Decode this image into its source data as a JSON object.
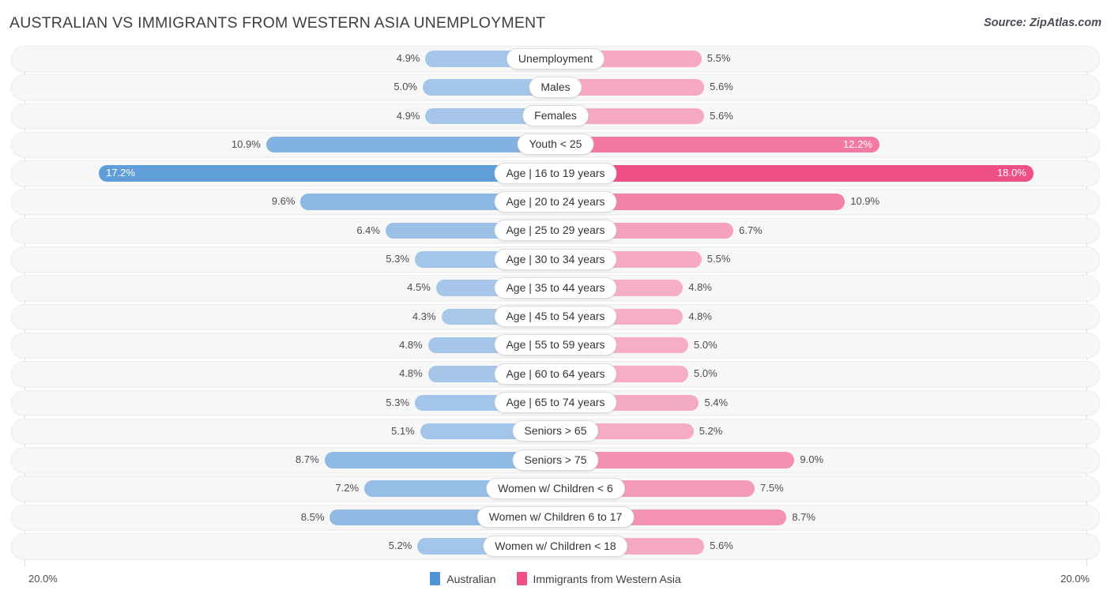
{
  "header": {
    "title": "AUSTRALIAN VS IMMIGRANTS FROM WESTERN ASIA UNEMPLOYMENT",
    "source": "Source: ZipAtlas.com"
  },
  "axis": {
    "left_label": "20.0%",
    "right_label": "20.0%",
    "max": 20.0
  },
  "legend": {
    "items": [
      {
        "label": "Australian",
        "color": "#4e94d4"
      },
      {
        "label": "Immigrants from Western Asia",
        "color": "#ef4f87"
      }
    ]
  },
  "colors": {
    "left_light": "#a8c8ea",
    "left_dark": "#5a9bd8",
    "right_light": "#f6b2c8",
    "right_dark": "#ef4f87",
    "track": "#f7f7f7",
    "gridline": "#e2e2e6"
  },
  "chart_data": {
    "type": "bar",
    "orientation": "horizontal-diverging",
    "title": "AUSTRALIAN VS IMMIGRANTS FROM WESTERN ASIA UNEMPLOYMENT",
    "xlabel": "",
    "ylabel": "",
    "xlim": [
      20.0,
      20.0
    ],
    "grid": true,
    "legend_position": "bottom-center",
    "unit": "%",
    "categories": [
      "Unemployment",
      "Males",
      "Females",
      "Youth < 25",
      "Age | 16 to 19 years",
      "Age | 20 to 24 years",
      "Age | 25 to 29 years",
      "Age | 30 to 34 years",
      "Age | 35 to 44 years",
      "Age | 45 to 54 years",
      "Age | 55 to 59 years",
      "Age | 60 to 64 years",
      "Age | 65 to 74 years",
      "Seniors > 65",
      "Seniors > 75",
      "Women w/ Children < 6",
      "Women w/ Children 6 to 17",
      "Women w/ Children < 18"
    ],
    "series": [
      {
        "name": "Australian",
        "values": [
          4.9,
          5.0,
          4.9,
          10.9,
          17.2,
          9.6,
          6.4,
          5.3,
          4.5,
          4.3,
          4.8,
          4.8,
          5.3,
          5.1,
          8.7,
          7.2,
          8.5,
          5.2
        ]
      },
      {
        "name": "Immigrants from Western Asia",
        "values": [
          5.5,
          5.6,
          5.6,
          12.2,
          18.0,
          10.9,
          6.7,
          5.5,
          4.8,
          4.8,
          5.0,
          5.0,
          5.4,
          5.2,
          9.0,
          7.5,
          8.7,
          5.6
        ]
      }
    ]
  },
  "rows": [
    {
      "label": "Unemployment",
      "left": 4.9,
      "left_text": "4.9%",
      "right": 5.5,
      "right_text": "5.5%"
    },
    {
      "label": "Males",
      "left": 5.0,
      "left_text": "5.0%",
      "right": 5.6,
      "right_text": "5.6%"
    },
    {
      "label": "Females",
      "left": 4.9,
      "left_text": "4.9%",
      "right": 5.6,
      "right_text": "5.6%"
    },
    {
      "label": "Youth < 25",
      "left": 10.9,
      "left_text": "10.9%",
      "right": 12.2,
      "right_text": "12.2%"
    },
    {
      "label": "Age | 16 to 19 years",
      "left": 17.2,
      "left_text": "17.2%",
      "right": 18.0,
      "right_text": "18.0%"
    },
    {
      "label": "Age | 20 to 24 years",
      "left": 9.6,
      "left_text": "9.6%",
      "right": 10.9,
      "right_text": "10.9%"
    },
    {
      "label": "Age | 25 to 29 years",
      "left": 6.4,
      "left_text": "6.4%",
      "right": 6.7,
      "right_text": "6.7%"
    },
    {
      "label": "Age | 30 to 34 years",
      "left": 5.3,
      "left_text": "5.3%",
      "right": 5.5,
      "right_text": "5.5%"
    },
    {
      "label": "Age | 35 to 44 years",
      "left": 4.5,
      "left_text": "4.5%",
      "right": 4.8,
      "right_text": "4.8%"
    },
    {
      "label": "Age | 45 to 54 years",
      "left": 4.3,
      "left_text": "4.3%",
      "right": 4.8,
      "right_text": "4.8%"
    },
    {
      "label": "Age | 55 to 59 years",
      "left": 4.8,
      "left_text": "4.8%",
      "right": 5.0,
      "right_text": "5.0%"
    },
    {
      "label": "Age | 60 to 64 years",
      "left": 4.8,
      "left_text": "4.8%",
      "right": 5.0,
      "right_text": "5.0%"
    },
    {
      "label": "Age | 65 to 74 years",
      "left": 5.3,
      "left_text": "5.3%",
      "right": 5.4,
      "right_text": "5.4%"
    },
    {
      "label": "Seniors > 65",
      "left": 5.1,
      "left_text": "5.1%",
      "right": 5.2,
      "right_text": "5.2%"
    },
    {
      "label": "Seniors > 75",
      "left": 8.7,
      "left_text": "8.7%",
      "right": 9.0,
      "right_text": "9.0%"
    },
    {
      "label": "Women w/ Children < 6",
      "left": 7.2,
      "left_text": "7.2%",
      "right": 7.5,
      "right_text": "7.5%"
    },
    {
      "label": "Women w/ Children 6 to 17",
      "left": 8.5,
      "left_text": "8.5%",
      "right": 8.7,
      "right_text": "8.7%"
    },
    {
      "label": "Women w/ Children < 18",
      "left": 5.2,
      "left_text": "5.2%",
      "right": 5.6,
      "right_text": "5.6%"
    }
  ]
}
